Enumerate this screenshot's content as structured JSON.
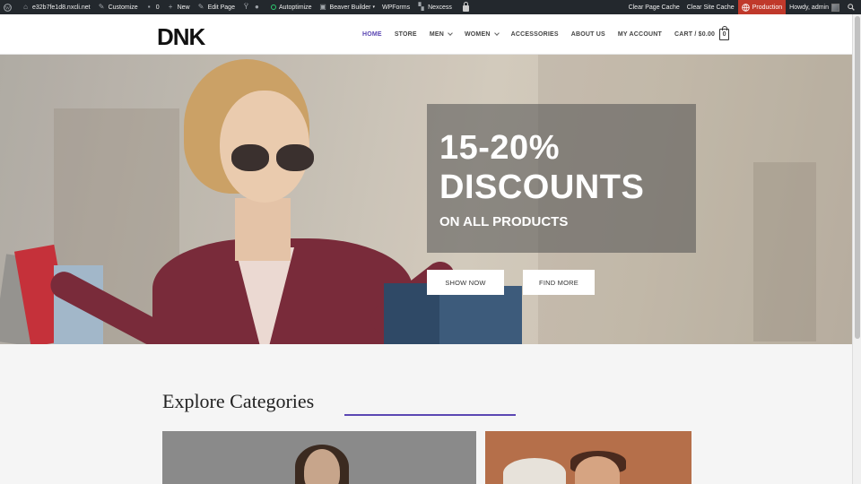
{
  "admin_bar": {
    "site": "e32b7fe1d8.nxcli.net",
    "customize": "Customize",
    "comments_count": "0",
    "new": "New",
    "edit_page": "Edit Page",
    "autoptimize": "Autoptimize",
    "beaver_builder": "Beaver Builder",
    "wpforms": "WPForms",
    "nexcess": "Nexcess",
    "clear_page_cache": "Clear Page Cache",
    "clear_site_cache": "Clear Site Cache",
    "production": "Production",
    "howdy": "Howdy, admin",
    "production_color": "#c0392b"
  },
  "header": {
    "logo": "DNK",
    "nav": [
      {
        "label": "HOME"
      },
      {
        "label": "STORE"
      },
      {
        "label": "MEN"
      },
      {
        "label": "WOMEN"
      },
      {
        "label": "ACCESSORIES"
      },
      {
        "label": "ABOUT US"
      },
      {
        "label": "MY ACCOUNT"
      }
    ],
    "cart_label": "CART / $0.00",
    "cart_count": "0",
    "accent_color": "#5b47b3"
  },
  "hero": {
    "line1": "15-20%",
    "line2": "DISCOUNTS",
    "line3": "ON ALL PRODUCTS",
    "btn_shop": "SHOW NOW",
    "btn_find": "FIND MORE"
  },
  "categories": {
    "title": "Explore Categories"
  }
}
